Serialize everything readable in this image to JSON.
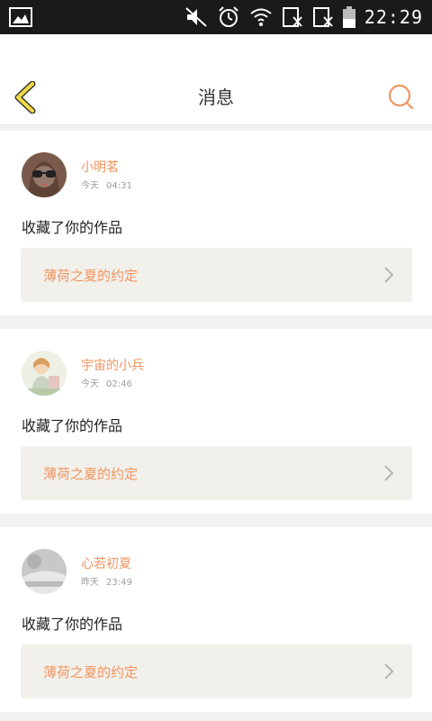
{
  "status_bar": {
    "time": "22:29",
    "icons": [
      "image-icon",
      "mute-icon",
      "alarm-icon",
      "wifi-icon",
      "sim-blocked-icon",
      "sim-blocked-icon",
      "battery-icon"
    ]
  },
  "header": {
    "title": "消息"
  },
  "notifications": [
    {
      "name": "小明茗",
      "day": "今天",
      "time": "04:31",
      "action": "收藏了你的作品",
      "work": "薄荷之夏的约定"
    },
    {
      "name": "宇宙的小兵",
      "day": "今天",
      "time": "02:46",
      "action": "收藏了你的作品",
      "work": "薄荷之夏的约定"
    },
    {
      "name": "心若初夏",
      "day": "昨天",
      "time": "23:49",
      "action": "收藏了你的作品",
      "work": "薄荷之夏的约定"
    }
  ],
  "colors": {
    "accent": "#f29460",
    "back_icon": "#f3db46",
    "work_bg": "#f1f0ea"
  }
}
